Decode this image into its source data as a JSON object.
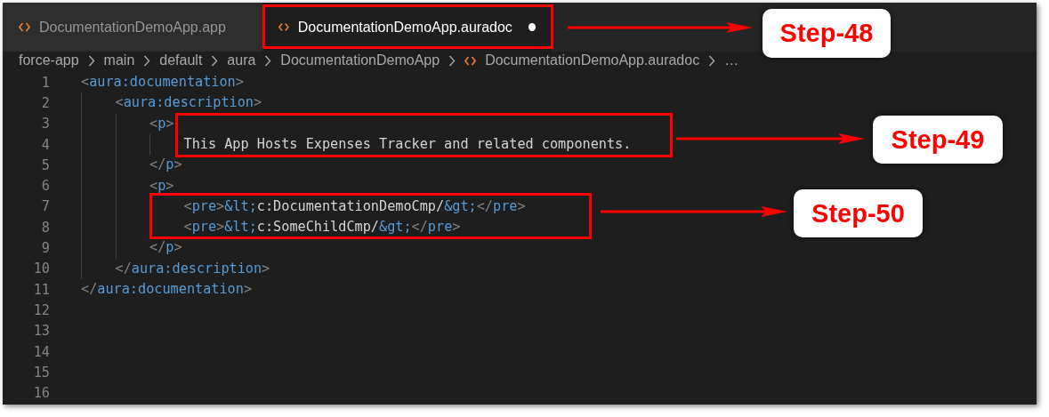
{
  "tabs": [
    {
      "label": "DocumentationDemoApp.app",
      "selected": false,
      "modified": false
    },
    {
      "label": "DocumentationDemoApp.auradoc",
      "selected": true,
      "modified": true
    }
  ],
  "breadcrumb": [
    {
      "label": "force-app",
      "kind": "folder"
    },
    {
      "label": "main",
      "kind": "folder"
    },
    {
      "label": "default",
      "kind": "folder"
    },
    {
      "label": "aura",
      "kind": "folder"
    },
    {
      "label": "DocumentationDemoApp",
      "kind": "folder"
    },
    {
      "label": "DocumentationDemoApp.auradoc",
      "kind": "file"
    },
    {
      "label": "…",
      "kind": "more"
    }
  ],
  "lines": [
    {
      "number": "1",
      "tokens": [
        {
          "kind": "punct",
          "text": "<"
        },
        {
          "kind": "tag",
          "text": "aura:documentation"
        },
        {
          "kind": "punct",
          "text": ">"
        }
      ],
      "children": [
        {
          "number": "2",
          "tokens": [
            {
              "kind": "punct",
              "text": "<"
            },
            {
              "kind": "tag",
              "text": "aura:description"
            },
            {
              "kind": "punct",
              "text": ">"
            }
          ],
          "children": [
            {
              "number": "3",
              "tokens": [
                {
                  "kind": "punct",
                  "text": "<"
                },
                {
                  "kind": "tag",
                  "text": "p"
                },
                {
                  "kind": "punct",
                  "text": ">"
                }
              ],
              "children": [
                {
                  "number": "4",
                  "tokens": [
                    {
                      "kind": "text",
                      "text": "This App Hosts Expenses Tracker and related components."
                    }
                  ]
                }
              ]
            },
            {
              "number": "5",
              "tokens": [
                {
                  "kind": "punct",
                  "text": "</"
                },
                {
                  "kind": "tag",
                  "text": "p"
                },
                {
                  "kind": "punct",
                  "text": ">"
                }
              ]
            },
            {
              "number": "6",
              "tokens": [
                {
                  "kind": "punct",
                  "text": "<"
                },
                {
                  "kind": "tag",
                  "text": "p"
                },
                {
                  "kind": "punct",
                  "text": ">"
                }
              ],
              "children": [
                {
                  "number": "7",
                  "tokens": [
                    {
                      "kind": "punct",
                      "text": "<"
                    },
                    {
                      "kind": "tag",
                      "text": "pre"
                    },
                    {
                      "kind": "punct",
                      "text": ">"
                    },
                    {
                      "kind": "entity",
                      "text": "&lt;"
                    },
                    {
                      "kind": "text",
                      "text": "c:DocumentationDemoCmp/"
                    },
                    {
                      "kind": "entity",
                      "text": "&gt;"
                    },
                    {
                      "kind": "punct",
                      "text": "</"
                    },
                    {
                      "kind": "tag",
                      "text": "pre"
                    },
                    {
                      "kind": "punct",
                      "text": ">"
                    }
                  ]
                },
                {
                  "number": "8",
                  "tokens": [
                    {
                      "kind": "punct",
                      "text": "<"
                    },
                    {
                      "kind": "tag",
                      "text": "pre"
                    },
                    {
                      "kind": "punct",
                      "text": ">"
                    },
                    {
                      "kind": "entity",
                      "text": "&lt;"
                    },
                    {
                      "kind": "text",
                      "text": "c:SomeChildCmp/"
                    },
                    {
                      "kind": "entity",
                      "text": "&gt;"
                    },
                    {
                      "kind": "punct",
                      "text": "</"
                    },
                    {
                      "kind": "tag",
                      "text": "pre"
                    },
                    {
                      "kind": "punct",
                      "text": ">"
                    }
                  ]
                }
              ]
            },
            {
              "number": "9",
              "tokens": [
                {
                  "kind": "punct",
                  "text": "</"
                },
                {
                  "kind": "tag",
                  "text": "p"
                },
                {
                  "kind": "punct",
                  "text": ">"
                }
              ]
            }
          ]
        },
        {
          "number": "10",
          "tokens": [
            {
              "kind": "punct",
              "text": "</"
            },
            {
              "kind": "tag",
              "text": "aura:description"
            },
            {
              "kind": "punct",
              "text": ">"
            }
          ]
        }
      ]
    },
    {
      "number": "11",
      "tokens": [
        {
          "kind": "punct",
          "text": "</"
        },
        {
          "kind": "tag",
          "text": "aura:documentation"
        },
        {
          "kind": "punct",
          "text": ">"
        }
      ]
    },
    {
      "number": "12"
    },
    {
      "number": "13"
    },
    {
      "number": "14"
    },
    {
      "number": "15"
    },
    {
      "number": "16"
    }
  ],
  "annotations": [
    {
      "label": "Step-48"
    },
    {
      "label": "Step-49"
    },
    {
      "label": "Step-50"
    }
  ]
}
